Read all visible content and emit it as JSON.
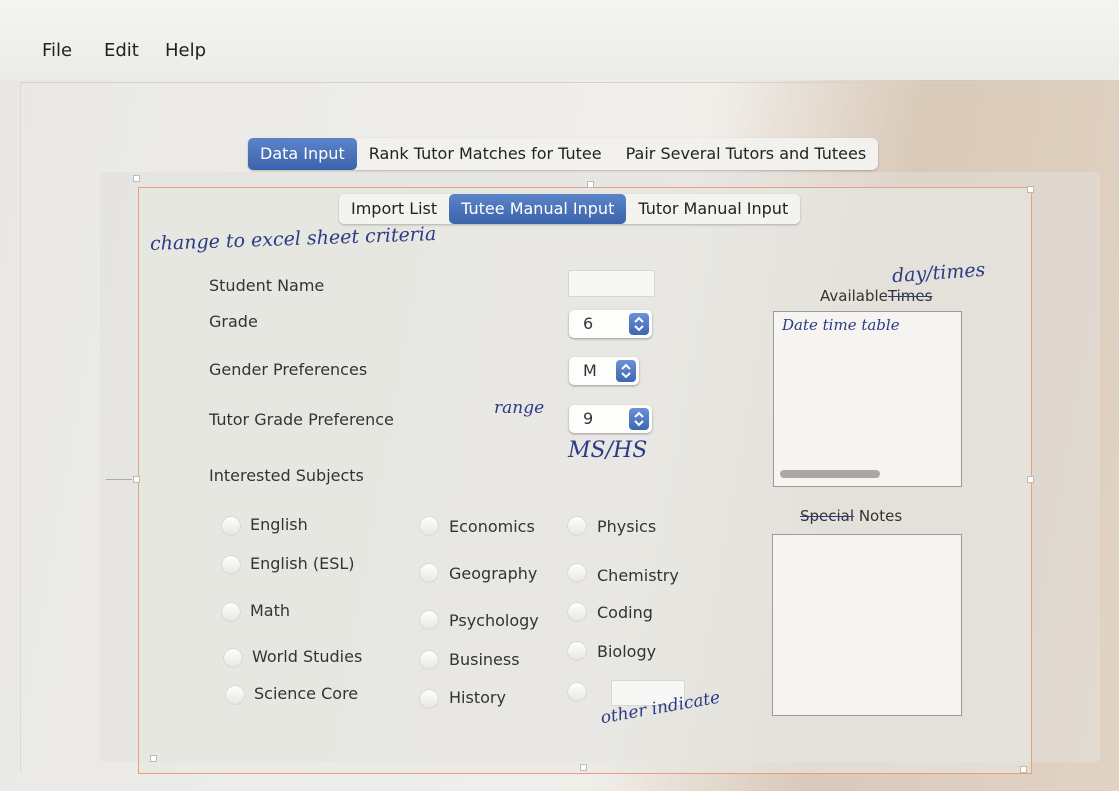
{
  "menu": {
    "items": [
      "File",
      "Edit",
      "Help"
    ]
  },
  "main_tabs": [
    {
      "label": "Data Input",
      "active": true
    },
    {
      "label": "Rank Tutor Matches for Tutee",
      "active": false
    },
    {
      "label": "Pair Several Tutors and Tutees",
      "active": false
    }
  ],
  "sub_tabs": [
    {
      "label": "Import List",
      "active": false
    },
    {
      "label": "Tutee Manual Input",
      "active": true
    },
    {
      "label": "Tutor Manual Input",
      "active": false
    }
  ],
  "form": {
    "student_name_label": "Student Name",
    "student_name_value": "",
    "grade_label": "Grade",
    "grade_value": "6",
    "gender_label": "Gender Preferences",
    "gender_value": "M",
    "tutor_grade_label": "Tutor Grade Preference",
    "tutor_grade_value": "9",
    "subjects_label": "Interested Subjects",
    "other_subject_value": ""
  },
  "subjects": {
    "col1": [
      "English",
      "English (ESL)",
      "Math",
      "World Studies",
      "Science Core"
    ],
    "col2": [
      "Economics",
      "Geography",
      "Psychology",
      "Business",
      "History"
    ],
    "col3": [
      "Physics",
      "Chemistry",
      "Coding",
      "Biology"
    ]
  },
  "available": {
    "label_prefix": "Available",
    "label_struck": "Times",
    "value": ""
  },
  "notes": {
    "label_struck": "Special",
    "label_suffix": "Notes",
    "value": ""
  },
  "handwritten": {
    "top_note": "change to excel sheet criteria",
    "day_times": "day/times",
    "date_time_table": "Date time table",
    "range": "range",
    "ms_hs": "MS/HS",
    "other_indicate": "other indicate"
  },
  "colors": {
    "accent": "#3b63ab",
    "pen": "#2d3a86",
    "selection": "#e4a27c"
  }
}
